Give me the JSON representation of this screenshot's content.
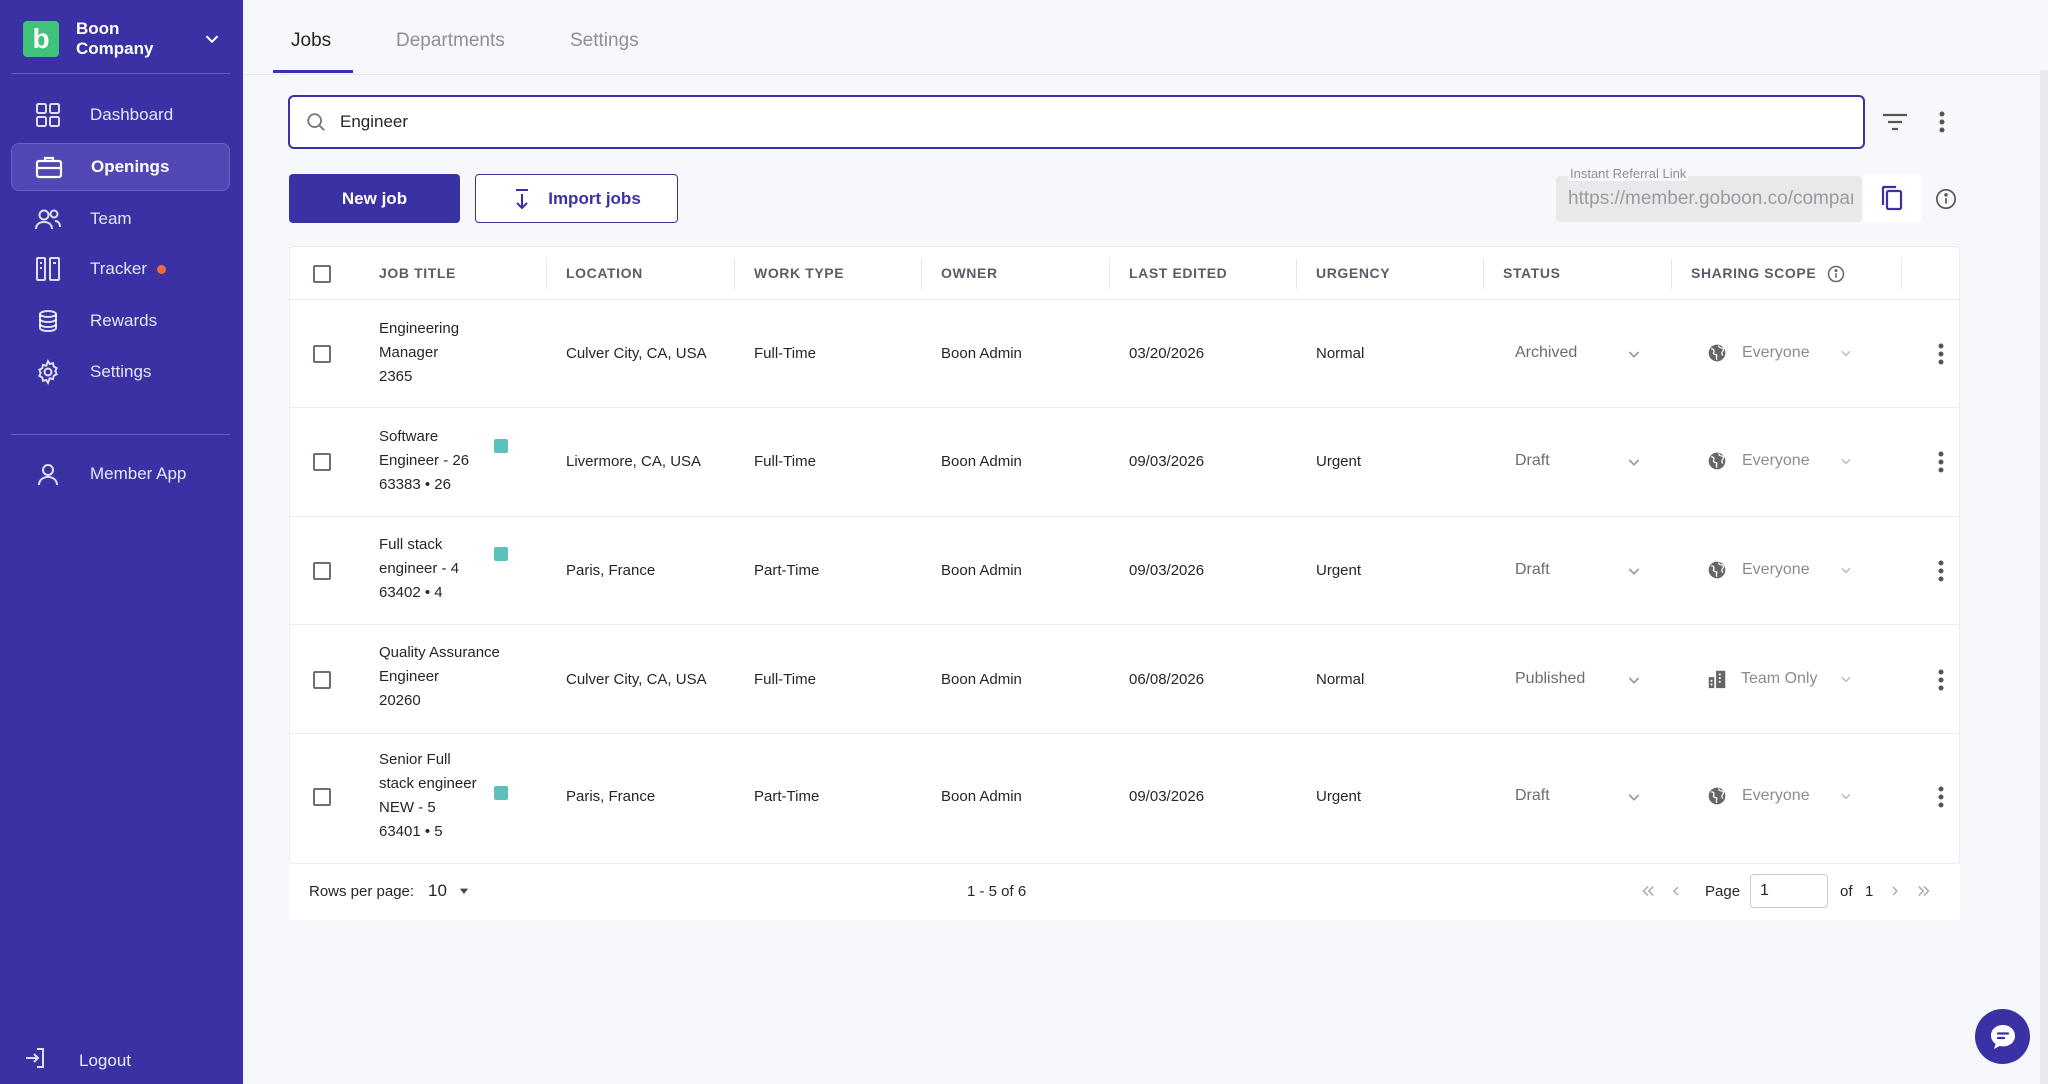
{
  "brand": {
    "logo_letter": "b",
    "name": "Boon Company"
  },
  "sidebar": {
    "items": [
      {
        "label": "Dashboard",
        "icon": "grid-icon"
      },
      {
        "label": "Openings",
        "icon": "briefcase-icon",
        "active": true
      },
      {
        "label": "Team",
        "icon": "people-icon"
      },
      {
        "label": "Tracker",
        "icon": "tracker-icon",
        "notification": true
      },
      {
        "label": "Rewards",
        "icon": "coins-icon"
      },
      {
        "label": "Settings",
        "icon": "gear-icon"
      }
    ],
    "member_app": "Member App",
    "logout": "Logout"
  },
  "tabs": [
    {
      "label": "Jobs",
      "active": true
    },
    {
      "label": "Departments"
    },
    {
      "label": "Settings"
    }
  ],
  "search": {
    "value": "Engineer"
  },
  "actions": {
    "new_job": "New job",
    "import_jobs": "Import jobs"
  },
  "referral": {
    "label": "Instant Referral Link",
    "value": "https://member.goboon.co/company"
  },
  "table": {
    "columns": [
      "JOB TITLE",
      "LOCATION",
      "WORK TYPE",
      "OWNER",
      "LAST EDITED",
      "URGENCY",
      "STATUS",
      "SHARING SCOPE"
    ],
    "rows": [
      {
        "title": [
          "Engineering",
          "Manager",
          "2365"
        ],
        "badge": false,
        "location": "Culver City, CA, USA",
        "work_type": "Full-Time",
        "owner": "Boon Admin",
        "last_edited": "03/20/2026",
        "urgency": "Normal",
        "status": "Archived",
        "scope": "Everyone",
        "scope_icon": "globe-icon"
      },
      {
        "title": [
          "Software",
          "Engineer - 26",
          "63383 • 26"
        ],
        "badge": true,
        "location": "Livermore, CA, USA",
        "work_type": "Full-Time",
        "owner": "Boon Admin",
        "last_edited": "09/03/2026",
        "urgency": "Urgent",
        "status": "Draft",
        "scope": "Everyone",
        "scope_icon": "globe-icon"
      },
      {
        "title": [
          "Full stack",
          "engineer - 4",
          "63402 • 4"
        ],
        "badge": true,
        "location": "Paris, France",
        "work_type": "Part-Time",
        "owner": "Boon Admin",
        "last_edited": "09/03/2026",
        "urgency": "Urgent",
        "status": "Draft",
        "scope": "Everyone",
        "scope_icon": "globe-icon"
      },
      {
        "title": [
          "Quality Assurance",
          "Engineer",
          "20260"
        ],
        "badge": false,
        "location": "Culver City, CA, USA",
        "work_type": "Full-Time",
        "owner": "Boon Admin",
        "last_edited": "06/08/2026",
        "urgency": "Normal",
        "status": "Published",
        "scope": "Team Only",
        "scope_icon": "building-icon"
      },
      {
        "title": [
          "Senior Full",
          "stack engineer",
          "NEW - 5",
          "63401 • 5"
        ],
        "badge": true,
        "location": "Paris, France",
        "work_type": "Part-Time",
        "owner": "Boon Admin",
        "last_edited": "09/03/2026",
        "urgency": "Urgent",
        "status": "Draft",
        "scope": "Everyone",
        "scope_icon": "globe-icon"
      }
    ]
  },
  "pagination": {
    "rows_per_page_label": "Rows per page:",
    "rows_per_page": "10",
    "range": "1 - 5 of 6",
    "page_label": "Page",
    "page": "1",
    "of_label": "of",
    "total_pages": "1"
  },
  "colors": {
    "brand": "#3a31a4",
    "logo": "#3fc37a",
    "dot": "#f26b3a",
    "badge": "#5bc2bb"
  }
}
